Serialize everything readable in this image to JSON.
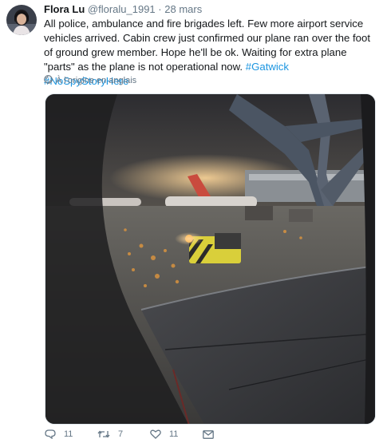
{
  "tweet": {
    "author_name": "Flora Lu",
    "handle": "@floralu_1991",
    "separator": "·",
    "date": "28 mars",
    "text_parts": [
      "All police, ambulance and fire brigades left. Few more airport service vehicles arrived. Cabin crew just confirmed our plane ran over the foot of ground grew member. Hope he'll be ok. Waiting for extra plane \"parts\" as the plane is not operational now. ",
      "#Gatwick",
      " ",
      "#NoSpyStoryHere"
    ],
    "translate_label": "À l'origine en anglais",
    "icons": {
      "globe": "globe-icon",
      "reply": "reply-icon",
      "retweet": "retweet-icon",
      "like": "heart-icon",
      "dm": "envelope-icon"
    },
    "actions": {
      "reply_count": "11",
      "retweet_count": "7",
      "like_count": "11"
    },
    "colors": {
      "hashtag": "#1b95e0",
      "muted": "#657786",
      "text": "#14171a"
    }
  }
}
